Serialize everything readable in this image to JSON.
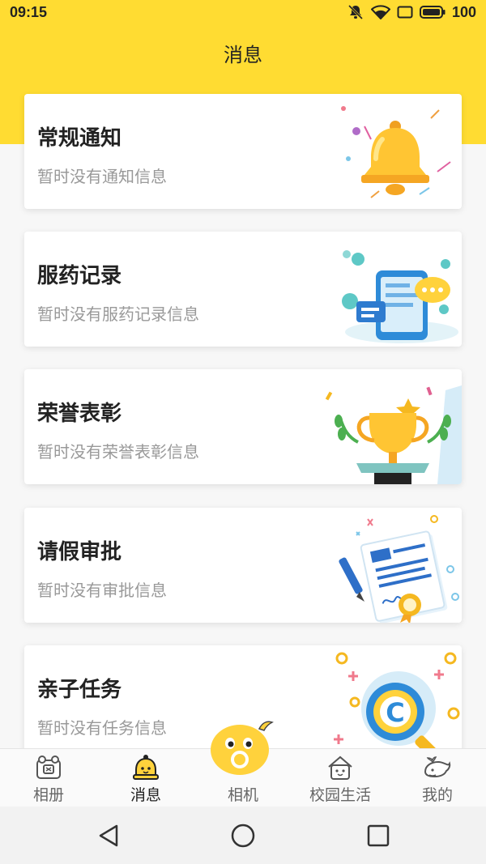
{
  "status_bar": {
    "time": "09:15",
    "battery": "100",
    "icons": [
      "notifications-off-icon",
      "wifi-icon",
      "screen-icon",
      "battery-icon"
    ]
  },
  "header": {
    "title": "消息"
  },
  "cards": [
    {
      "title": "常规通知",
      "subtitle": "暂时没有通知信息",
      "icon": "bell-illustration-icon"
    },
    {
      "title": "服药记录",
      "subtitle": "暂时没有服药记录信息",
      "icon": "phone-chat-illustration-icon"
    },
    {
      "title": "荣誉表彰",
      "subtitle": "暂时没有荣誉表彰信息",
      "icon": "trophy-illustration-icon"
    },
    {
      "title": "请假审批",
      "subtitle": "暂时没有审批信息",
      "icon": "document-pen-illustration-icon"
    },
    {
      "title": "亲子任务",
      "subtitle": "暂时没有任务信息",
      "icon": "magnifier-c-illustration-icon"
    }
  ],
  "tabbar": {
    "items": [
      {
        "label": "相册",
        "icon": "album-icon",
        "active": false
      },
      {
        "label": "消息",
        "icon": "bell-face-icon",
        "active": true
      },
      {
        "label": "相机",
        "icon": "camera-blob-icon",
        "active": false
      },
      {
        "label": "校园生活",
        "icon": "school-house-icon",
        "active": false
      },
      {
        "label": "我的",
        "icon": "whale-icon",
        "active": false
      }
    ]
  },
  "colors": {
    "brand": "#ffdc32",
    "title_text": "#222222",
    "subtitle_text": "#999999"
  }
}
